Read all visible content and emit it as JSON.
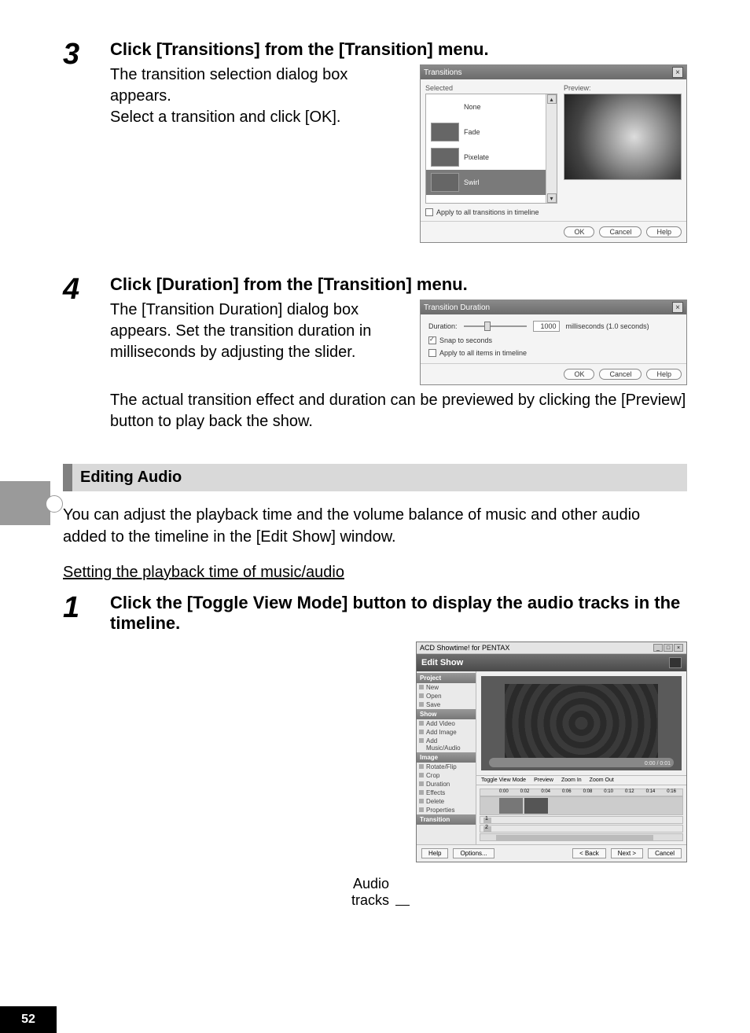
{
  "page_number": "52",
  "step3": {
    "num": "3",
    "title": "Click [Transitions] from the [Transition] menu.",
    "text": "The transition selection dialog box appears.\nSelect a transition and click [OK].",
    "dialog": {
      "title": "Transitions",
      "selected_label": "Selected",
      "preview_label": "Preview:",
      "items": [
        "None",
        "Fade",
        "Pixelate",
        "Swirl"
      ],
      "apply_all": "Apply to all transitions in timeline",
      "ok": "OK",
      "cancel": "Cancel",
      "help": "Help"
    }
  },
  "step4": {
    "num": "4",
    "title": "Click [Duration] from the [Transition] menu.",
    "text_a": "The [Transition Duration] dialog box appears. Set the transition duration in milliseconds by adjusting the slider.",
    "text_b": "The actual transition effect and duration can be previewed by clicking the [Preview] button to play back the show.",
    "dialog": {
      "title": "Transition Duration",
      "duration_label": "Duration:",
      "value": "1000",
      "unit": "milliseconds (1.0 seconds)",
      "snap": "Snap to seconds",
      "apply_all": "Apply to all items in timeline",
      "ok": "OK",
      "cancel": "Cancel",
      "help": "Help"
    }
  },
  "section": {
    "heading": "Editing Audio",
    "body": "You can adjust the playback time and the volume balance of music and other audio added to the timeline in the [Edit Show] window.",
    "subheading": "Setting the playback time of music/audio"
  },
  "step1": {
    "num": "1",
    "title": "Click the [Toggle View Mode] button to display the audio tracks in the timeline.",
    "audio_label_line1": "Audio",
    "audio_label_line2": "tracks",
    "editshow": {
      "wintitle": "ACD Showtime! for PENTAX",
      "header": "Edit Show",
      "sidebar": {
        "project_title": "Project",
        "project_items": [
          "New",
          "Open",
          "Save"
        ],
        "show_title": "Show",
        "show_items": [
          "Add Video",
          "Add Image",
          "Add Music/Audio"
        ],
        "image_title": "Image",
        "image_items": [
          "Rotate/Flip",
          "Crop",
          "Duration",
          "Effects",
          "Delete",
          "Properties"
        ],
        "transition_title": "Transition"
      },
      "preview_time": "0:00 / 0:01",
      "toolbar": [
        "Toggle View Mode",
        "Preview",
        "Zoom In",
        "Zoom Out"
      ],
      "ruler": [
        "0:00",
        "0:02",
        "0:04",
        "0:06",
        "0:08",
        "0:10",
        "0:12",
        "0:14",
        "0:16"
      ],
      "audio1": "1",
      "audio2": "2",
      "footer": {
        "help": "Help",
        "options": "Options...",
        "back": "< Back",
        "next": "Next >",
        "cancel": "Cancel"
      }
    }
  }
}
